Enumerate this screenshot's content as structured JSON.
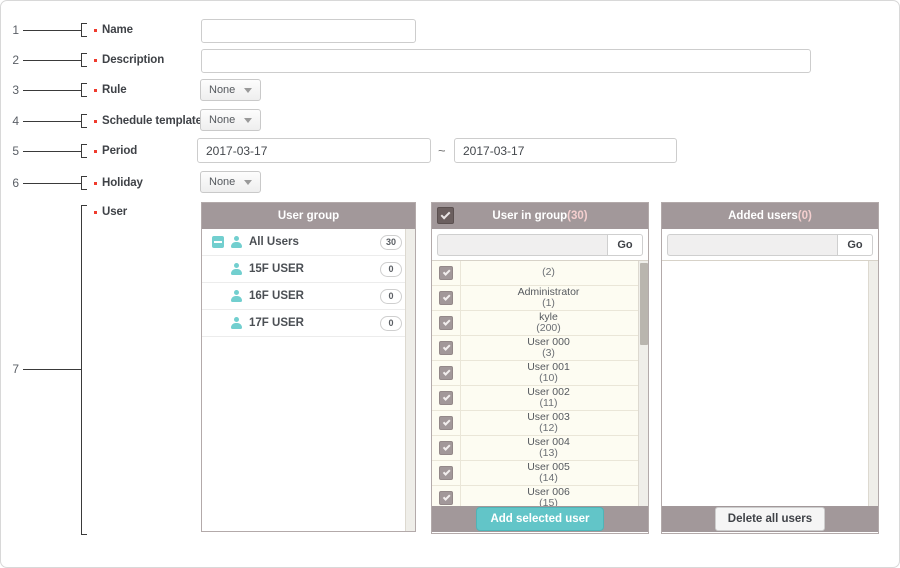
{
  "callouts": [
    {
      "num": "1"
    },
    {
      "num": "2"
    },
    {
      "num": "3"
    },
    {
      "num": "4"
    },
    {
      "num": "5"
    },
    {
      "num": "6"
    },
    {
      "num": "7"
    }
  ],
  "form": {
    "name": {
      "label": "Name",
      "value": "",
      "placeholder": ""
    },
    "description": {
      "label": "Description",
      "value": "",
      "placeholder": ""
    },
    "rule": {
      "label": "Rule",
      "value": "None"
    },
    "schedule_template": {
      "label": "Schedule template",
      "value": "None"
    },
    "period": {
      "label": "Period",
      "start": "2017-03-17",
      "end": "2017-03-17",
      "separator": "~"
    },
    "holiday": {
      "label": "Holiday",
      "value": "None"
    },
    "user": {
      "label": "User"
    }
  },
  "user_group_panel": {
    "title": "User group",
    "rows": [
      {
        "label": "All Users",
        "count": "30",
        "expandable": true
      },
      {
        "label": "15F USER",
        "count": "0",
        "expandable": false
      },
      {
        "label": "16F USER",
        "count": "0",
        "expandable": false
      },
      {
        "label": "17F USER",
        "count": "0",
        "expandable": false
      }
    ]
  },
  "user_in_group_panel": {
    "title": "User in group",
    "count": "(30)",
    "search": {
      "value": "",
      "placeholder": ""
    },
    "go_label": "Go",
    "rows": [
      {
        "name": "",
        "id": "(2)"
      },
      {
        "name": "Administrator",
        "id": "(1)"
      },
      {
        "name": "kyle",
        "id": "(200)"
      },
      {
        "name": "User 000",
        "id": "(3)"
      },
      {
        "name": "User 001",
        "id": "(10)"
      },
      {
        "name": "User 002",
        "id": "(11)"
      },
      {
        "name": "User 003",
        "id": "(12)"
      },
      {
        "name": "User 004",
        "id": "(13)"
      },
      {
        "name": "User 005",
        "id": "(14)"
      },
      {
        "name": "User 006",
        "id": "(15)"
      }
    ],
    "add_button": "Add selected user"
  },
  "added_users_panel": {
    "title": "Added users",
    "count": "(0)",
    "search": {
      "value": "",
      "placeholder": ""
    },
    "go_label": "Go",
    "rows": [],
    "delete_button": "Delete all users"
  },
  "colors": {
    "panel_header": "#a2989a",
    "accent_teal": "#62c5c8",
    "required_marker": "#ef3b2d",
    "list_background": "#fdfcf2"
  }
}
